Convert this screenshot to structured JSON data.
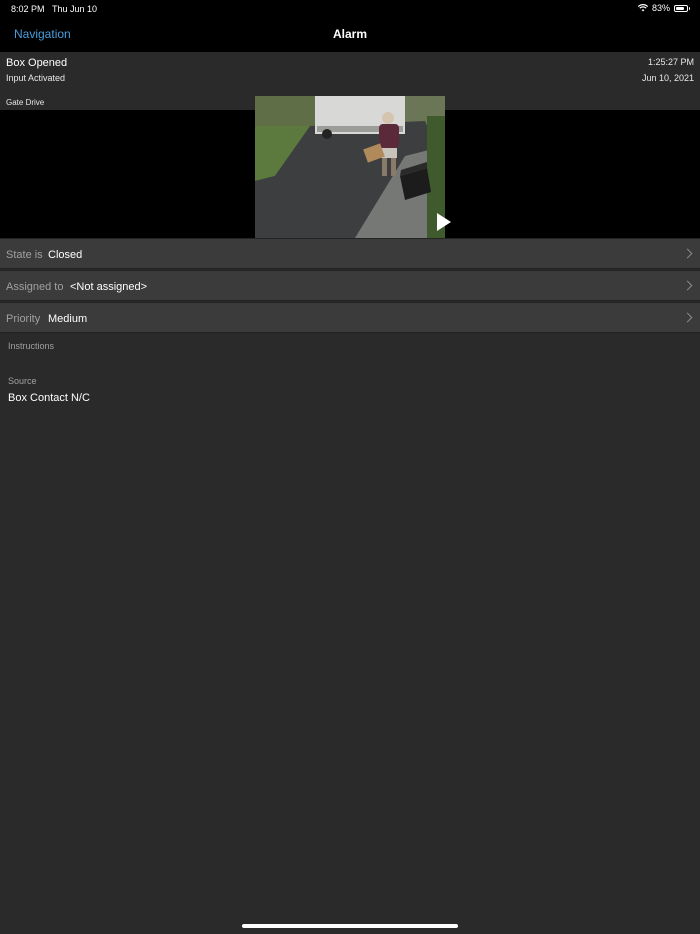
{
  "status_bar": {
    "time": "8:02 PM",
    "date": "Thu Jun 10",
    "battery": "83%",
    "battery_level": 0.83,
    "wifi_icon": "wifi-icon",
    "battery_icon": "battery-icon"
  },
  "nav": {
    "back_label": "Navigation",
    "title": "Alarm"
  },
  "event": {
    "title": "Box Opened",
    "subtitle": "Input Activated",
    "time": "1:25:27 PM",
    "date": "Jun 10, 2021",
    "camera": "Gate Drive"
  },
  "video": {
    "play_icon": "play-icon"
  },
  "rows": {
    "state": {
      "label": "State is",
      "value": "Closed"
    },
    "assigned": {
      "label": "Assigned to",
      "value": "<Not assigned>"
    },
    "priority": {
      "label": "Priority",
      "value": "Medium"
    }
  },
  "instructions": {
    "label": "Instructions"
  },
  "source": {
    "label": "Source",
    "value": "Box Contact N/C"
  },
  "colors": {
    "accent": "#4a9ee0",
    "background": "#2a2a2a",
    "row_background": "#3b3b3b",
    "bar_background": "#000000"
  }
}
